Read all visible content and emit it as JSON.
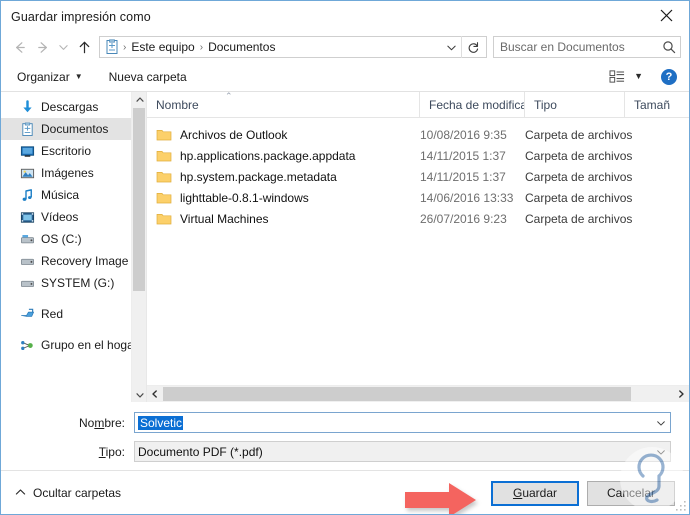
{
  "window": {
    "title": "Guardar impresión como",
    "close_icon": "close-icon"
  },
  "navbar": {
    "back_icon": "back-arrow-icon",
    "forward_icon": "forward-arrow-icon",
    "recent_icon": "chevron-down-icon",
    "up_icon": "up-arrow-icon",
    "path_icon": "computer-folder-icon",
    "breadcrumbs": [
      "Este equipo",
      "Documentos"
    ],
    "separator": "›",
    "dropdown_icon": "chevron-down-icon",
    "refresh_icon": "refresh-icon",
    "search": {
      "placeholder": "Buscar en Documentos",
      "icon": "search-icon"
    }
  },
  "toolbar": {
    "organize_label": "Organizar",
    "organize_caret": "▼",
    "new_folder_label": "Nueva carpeta",
    "view_icon": "view-layout-icon",
    "view_caret": "▼",
    "help_label": "?",
    "help_icon": "help-icon"
  },
  "sidebar": {
    "scroll_up_icon": "scroll-up-icon",
    "scroll_down_icon": "scroll-down-icon",
    "items": [
      {
        "label": "Descargas",
        "icon": "downloads-icon",
        "selected": false
      },
      {
        "label": "Documentos",
        "icon": "documents-icon",
        "selected": true
      },
      {
        "label": "Escritorio",
        "icon": "desktop-icon",
        "selected": false
      },
      {
        "label": "Imágenes",
        "icon": "pictures-icon",
        "selected": false
      },
      {
        "label": "Música",
        "icon": "music-icon",
        "selected": false
      },
      {
        "label": "Vídeos",
        "icon": "videos-icon",
        "selected": false
      },
      {
        "label": "OS (C:)",
        "icon": "drive-icon",
        "selected": false
      },
      {
        "label": "Recovery Image",
        "icon": "drive-icon",
        "selected": false
      },
      {
        "label": "SYSTEM (G:)",
        "icon": "drive-icon",
        "selected": false
      },
      {
        "label": "Red",
        "icon": "network-icon",
        "selected": false
      },
      {
        "label": "Grupo en el hogar",
        "icon": "homegroup-icon",
        "selected": false
      }
    ]
  },
  "filelist": {
    "columns": [
      "Nombre",
      "Fecha de modifica...",
      "Tipo",
      "Tamañ"
    ],
    "sort_caret": "⌃",
    "rows": [
      {
        "name": "Archivos de Outlook",
        "date": "10/08/2016 9:35",
        "type": "Carpeta de archivos",
        "size": "",
        "icon": "folder-icon"
      },
      {
        "name": "hp.applications.package.appdata",
        "date": "14/11/2015 1:37",
        "type": "Carpeta de archivos",
        "size": "",
        "icon": "folder-icon"
      },
      {
        "name": "hp.system.package.metadata",
        "date": "14/11/2015 1:37",
        "type": "Carpeta de archivos",
        "size": "",
        "icon": "folder-icon"
      },
      {
        "name": "lighttable-0.8.1-windows",
        "date": "14/06/2016 13:33",
        "type": "Carpeta de archivos",
        "size": "",
        "icon": "folder-icon"
      },
      {
        "name": "Virtual Machines",
        "date": "26/07/2016 9:23",
        "type": "Carpeta de archivos",
        "size": "",
        "icon": "folder-icon"
      }
    ],
    "hscroll_left_icon": "chevron-left-icon",
    "hscroll_right_icon": "chevron-right-icon"
  },
  "form": {
    "name_label": "Nombre:",
    "name_value": "Solvetic",
    "name_caret": "⌄",
    "type_label": "Tipo:",
    "type_value": "Documento PDF (*.pdf)",
    "type_caret": "⌄"
  },
  "footer": {
    "hide_folders_label": "Ocultar carpetas",
    "hide_folders_icon": "chevron-up-icon",
    "save_label": "Guardar",
    "cancel_label": "Cancelar",
    "annotation_icon": "red-arrow-annotation"
  },
  "colors": {
    "accent": "#0b6fd4",
    "selection": "#0b6fd4",
    "annotation_arrow": "#f4645f",
    "sidebar_selected": "#e3e3e3",
    "window_border": "#6fa8d8"
  }
}
